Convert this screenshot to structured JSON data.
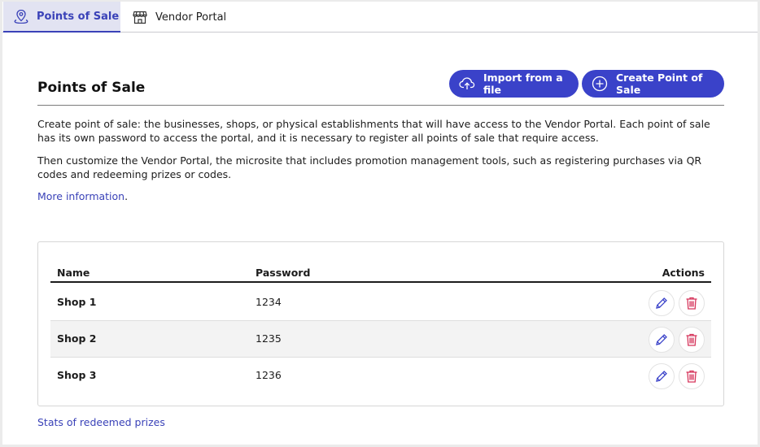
{
  "tabs": [
    {
      "label": "Points of Sale",
      "icon": "location-pin-icon",
      "active": true
    },
    {
      "label": "Vendor Portal",
      "icon": "storefront-icon",
      "active": false
    }
  ],
  "page": {
    "title": "Points of Sale",
    "import_label": "Import from a file",
    "create_label": "Create Point of Sale",
    "paragraph1": "Create point of sale: the businesses, shops, or physical establishments that will have access to the Vendor Portal. Each point of sale has its own password to access the portal, and it is necessary to register all points of sale that require access.",
    "paragraph2": "Then customize the Vendor Portal, the microsite that includes promotion management tools, such as registering purchases via QR codes and redeeming prizes or codes.",
    "more_info": "More information",
    "more_info_suffix": "."
  },
  "table": {
    "headers": {
      "name": "Name",
      "password": "Password",
      "actions": "Actions"
    },
    "rows": [
      {
        "name": "Shop 1",
        "password": "1234"
      },
      {
        "name": "Shop 2",
        "password": "1235"
      },
      {
        "name": "Shop 3",
        "password": "1236"
      }
    ]
  },
  "footer": {
    "stats_link": "Stats of redeemed prizes"
  },
  "colors": {
    "accent": "#3a42c9",
    "delete": "#d6365c",
    "tab_active_bg": "#e2e3f2"
  }
}
